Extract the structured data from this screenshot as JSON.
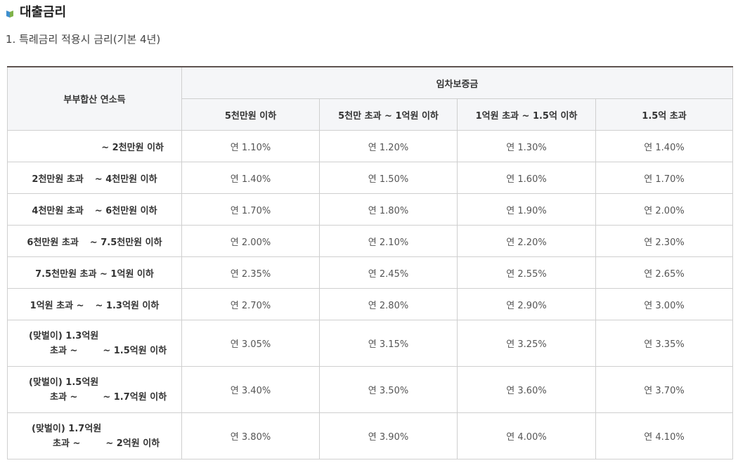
{
  "heading": {
    "title": "대출금리",
    "icon": "book-icon",
    "icon_colors": [
      "#3f8fcf",
      "#7fb24a"
    ]
  },
  "subheading": "1. 특례금리 적용시 금리(기본 4년)",
  "table": {
    "row_header": "부부합산 연소득",
    "group_header": "임차보증금",
    "columns": [
      "5천만원 이하",
      "5천만 초과 ~ 1억원 이하",
      "1억원 초과 ~ 1.5억 이하",
      "1.5억 초과"
    ],
    "rows": [
      {
        "income_a": "",
        "income_b": "~ 2천만원 이하",
        "rates": [
          "연 1.10%",
          "연 1.20%",
          "연 1.30%",
          "연 1.40%"
        ]
      },
      {
        "income_a": "2천만원 초과",
        "income_b": "~ 4천만원 이하",
        "rates": [
          "연 1.40%",
          "연 1.50%",
          "연 1.60%",
          "연 1.70%"
        ]
      },
      {
        "income_a": "4천만원 초과",
        "income_b": "~ 6천만원 이하",
        "rates": [
          "연 1.70%",
          "연 1.80%",
          "연 1.90%",
          "연 2.00%"
        ]
      },
      {
        "income_a": "6천만원 초과",
        "income_b": "~ 7.5천만원 이하",
        "rates": [
          "연 2.00%",
          "연 2.10%",
          "연 2.20%",
          "연 2.30%"
        ]
      },
      {
        "income_a": "7.5천만원 초과",
        "income_b": "~ 1억원 이하",
        "rates": [
          "연 2.35%",
          "연 2.45%",
          "연 2.55%",
          "연 2.65%"
        ]
      },
      {
        "income_a": "1억원 초과 ~",
        "income_b": "~ 1.3억원 이하",
        "rates": [
          "연 2.70%",
          "연 2.80%",
          "연 2.90%",
          "연 3.00%"
        ]
      },
      {
        "income_a": "(맞벌이) 1.3억원",
        "income_b": "초과 ~",
        "income_c": "~ 1.5억원 이하",
        "rates": [
          "연 3.05%",
          "연 3.15%",
          "연 3.25%",
          "연 3.35%"
        ]
      },
      {
        "income_a": "(맞벌이) 1.5억원",
        "income_b": "초과 ~",
        "income_c": "~ 1.7억원 이하",
        "rates": [
          "연 3.40%",
          "연 3.50%",
          "연 3.60%",
          "연 3.70%"
        ]
      },
      {
        "income_a": "(맞벌이) 1.7억원",
        "income_b": "초과 ~",
        "income_c": "~ 2억원 이하",
        "rates": [
          "연 3.80%",
          "연 3.90%",
          "연 4.00%",
          "연 4.10%"
        ]
      }
    ]
  }
}
